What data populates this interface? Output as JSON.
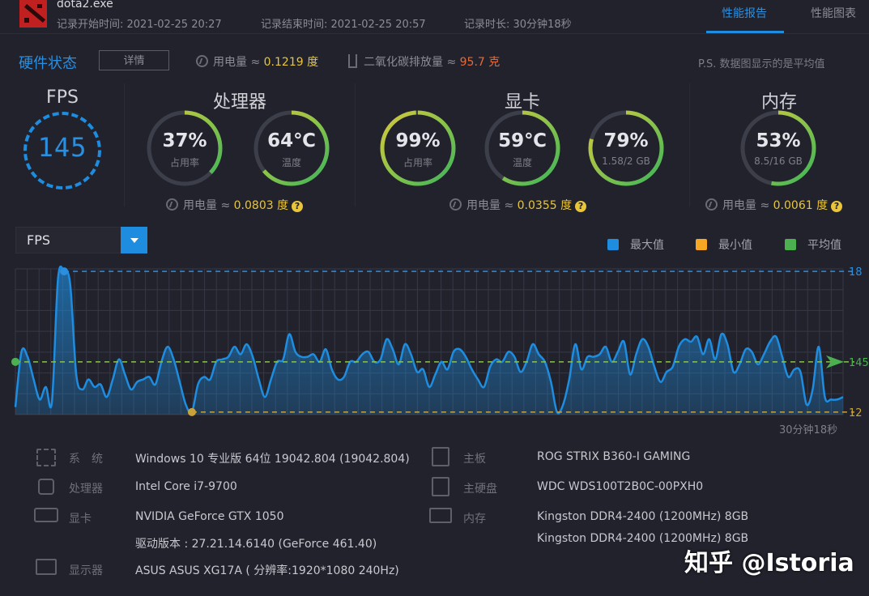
{
  "header": {
    "app_name": "dota2.exe",
    "start_time": "记录开始时间: 2021-02-25 20:27",
    "end_time": "记录结束时间: 2021-02-25 20:57",
    "duration": "记录时长: 30分钟18秒",
    "tabs": [
      {
        "label": "性能报告",
        "active": true
      },
      {
        "label": "性能图表",
        "active": false
      }
    ]
  },
  "status": {
    "title": "硬件状态",
    "detail_button": "详情",
    "power_label": "用电量 ≈",
    "power_value": "0.1219 度",
    "co2_label": "二氧化碳排放量 ≈",
    "co2_value": "95.7 克",
    "note": "P.S. 数据图显示的是平均值"
  },
  "fps": {
    "title": "FPS",
    "value": "145"
  },
  "cpu": {
    "title": "处理器",
    "usage": {
      "value": "37%",
      "label": "占用率",
      "fraction": 0.37
    },
    "temp": {
      "value": "64℃",
      "label": "温度",
      "fraction": 0.64
    },
    "power_label": "用电量 ≈",
    "power_value": "0.0803 度"
  },
  "gpu": {
    "title": "显卡",
    "usage": {
      "value": "99%",
      "label": "占用率",
      "fraction": 0.99
    },
    "temp": {
      "value": "59℃",
      "label": "温度",
      "fraction": 0.59
    },
    "memory": {
      "value": "79%",
      "label": "1.58/2 GB",
      "fraction": 0.79
    },
    "power_label": "用电量 ≈",
    "power_value": "0.0355 度"
  },
  "memory": {
    "title": "内存",
    "usage": {
      "value": "53%",
      "label": "8.5/16 GB",
      "fraction": 0.53
    },
    "power_label": "用电量 ≈",
    "power_value": "0.0061 度"
  },
  "chart_controls": {
    "selected_metric": "FPS",
    "legend": [
      {
        "label": "最大值",
        "color": "#1e8de0"
      },
      {
        "label": "最小值",
        "color": "#f5a623"
      },
      {
        "label": "平均值",
        "color": "#4cb050"
      }
    ],
    "duration_label": "30分钟18秒"
  },
  "chart_data": {
    "type": "area",
    "title": "FPS",
    "xlabel": "",
    "ylabel": "FPS",
    "x_end_label": "30分钟18秒",
    "ylim": [
      124,
      182
    ],
    "max": {
      "label": "18",
      "value": 181
    },
    "avg": {
      "label": "145",
      "value": 145
    },
    "min": {
      "label": "12",
      "value": 125
    },
    "values": [
      127,
      149,
      147,
      138,
      130,
      135,
      129,
      178,
      181,
      176,
      140,
      134,
      138,
      135,
      136,
      131,
      138,
      146,
      140,
      134,
      137,
      138,
      139,
      136,
      145,
      151,
      146,
      137,
      128,
      125,
      136,
      139,
      138,
      145,
      146,
      147,
      151,
      148,
      152,
      147,
      138,
      131,
      138,
      145,
      146,
      156,
      149,
      147,
      147,
      148,
      145,
      150,
      142,
      138,
      139,
      145,
      145,
      148,
      149,
      145,
      146,
      154,
      150,
      144,
      152,
      148,
      141,
      142,
      135,
      140,
      145,
      142,
      149,
      150,
      147,
      142,
      138,
      135,
      143,
      146,
      145,
      149,
      147,
      141,
      145,
      152,
      148,
      145,
      137,
      125,
      128,
      138,
      152,
      142,
      147,
      147,
      148,
      151,
      145,
      149,
      153,
      140,
      148,
      154,
      151,
      143,
      137,
      141,
      143,
      151,
      154,
      153,
      155,
      148,
      154,
      146,
      156,
      152,
      141,
      144,
      150,
      149,
      144,
      148,
      153,
      155,
      147,
      139,
      142,
      141,
      128,
      134,
      151,
      131,
      130,
      130,
      131
    ],
    "legend_position": "top-right",
    "grid": true
  },
  "system_info": {
    "left": [
      {
        "icon": "windows-icon",
        "label": "系　统",
        "value": "Windows 10 专业版 64位   19042.804 (19042.804)"
      },
      {
        "icon": "cpu-icon",
        "label": "处理器",
        "value": "Intel Core i7-9700"
      },
      {
        "icon": "gpu-icon",
        "label": "显卡",
        "value": "NVIDIA GeForce GTX 1050"
      },
      {
        "icon": "",
        "label": "",
        "value": "驱动版本 : 27.21.14.6140 (GeForce 461.40)"
      },
      {
        "icon": "monitor-icon",
        "label": "显示器",
        "value": "ASUS ASUS XG17A ( 分辨率:1920*1080 240Hz)"
      }
    ],
    "right": [
      {
        "icon": "motherboard-icon",
        "label": "主板",
        "value": "ROG STRIX B360-I GAMING"
      },
      {
        "icon": "disk-icon",
        "label": "主硬盘",
        "value": "WDC WDS100T2B0C-00PXH0"
      },
      {
        "icon": "ram-icon",
        "label": "内存",
        "value": "Kingston DDR4-2400 (1200MHz) 8GB"
      },
      {
        "icon": "",
        "label": "",
        "value": "Kingston DDR4-2400 (1200MHz) 8GB"
      }
    ]
  },
  "watermark": "知乎 @Istoria"
}
